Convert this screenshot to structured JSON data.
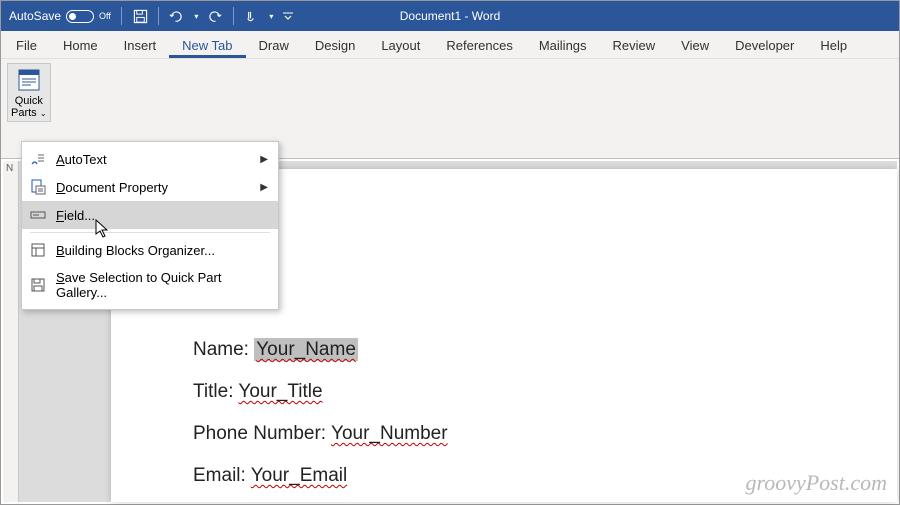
{
  "titlebar": {
    "autosave": "AutoSave",
    "autosave_state": "Off",
    "document_title": "Document1 - Word"
  },
  "tabs": {
    "file": "File",
    "home": "Home",
    "insert": "Insert",
    "new_tab": "New Tab",
    "draw": "Draw",
    "design": "Design",
    "layout": "Layout",
    "references": "References",
    "mailings": "Mailings",
    "review": "Review",
    "view": "View",
    "developer": "Developer",
    "help": "Help"
  },
  "ribbon": {
    "quick_parts_line1": "Quick",
    "quick_parts_line2": "Parts"
  },
  "dropdown": {
    "autotext_prefix": "A",
    "autotext_rest": "utoText",
    "docprop_prefix": "D",
    "docprop_rest": "ocument Property",
    "field_prefix": "F",
    "field_rest": "ield...",
    "bbo_prefix": "B",
    "bbo_rest": "uilding Blocks Organizer...",
    "save_prefix": "S",
    "save_rest": "ave Selection to Quick Part Gallery..."
  },
  "document": {
    "name_label": "Name: ",
    "name_value": "Your_Name",
    "title_label": "Title: ",
    "title_value": "Your_Title",
    "phone_label": "Phone Number: ",
    "phone_value": "Your_Number",
    "email_label": "Email: ",
    "email_value": "Your_Email"
  },
  "watermark": "groovyPost.com",
  "ruler_marker": "N"
}
